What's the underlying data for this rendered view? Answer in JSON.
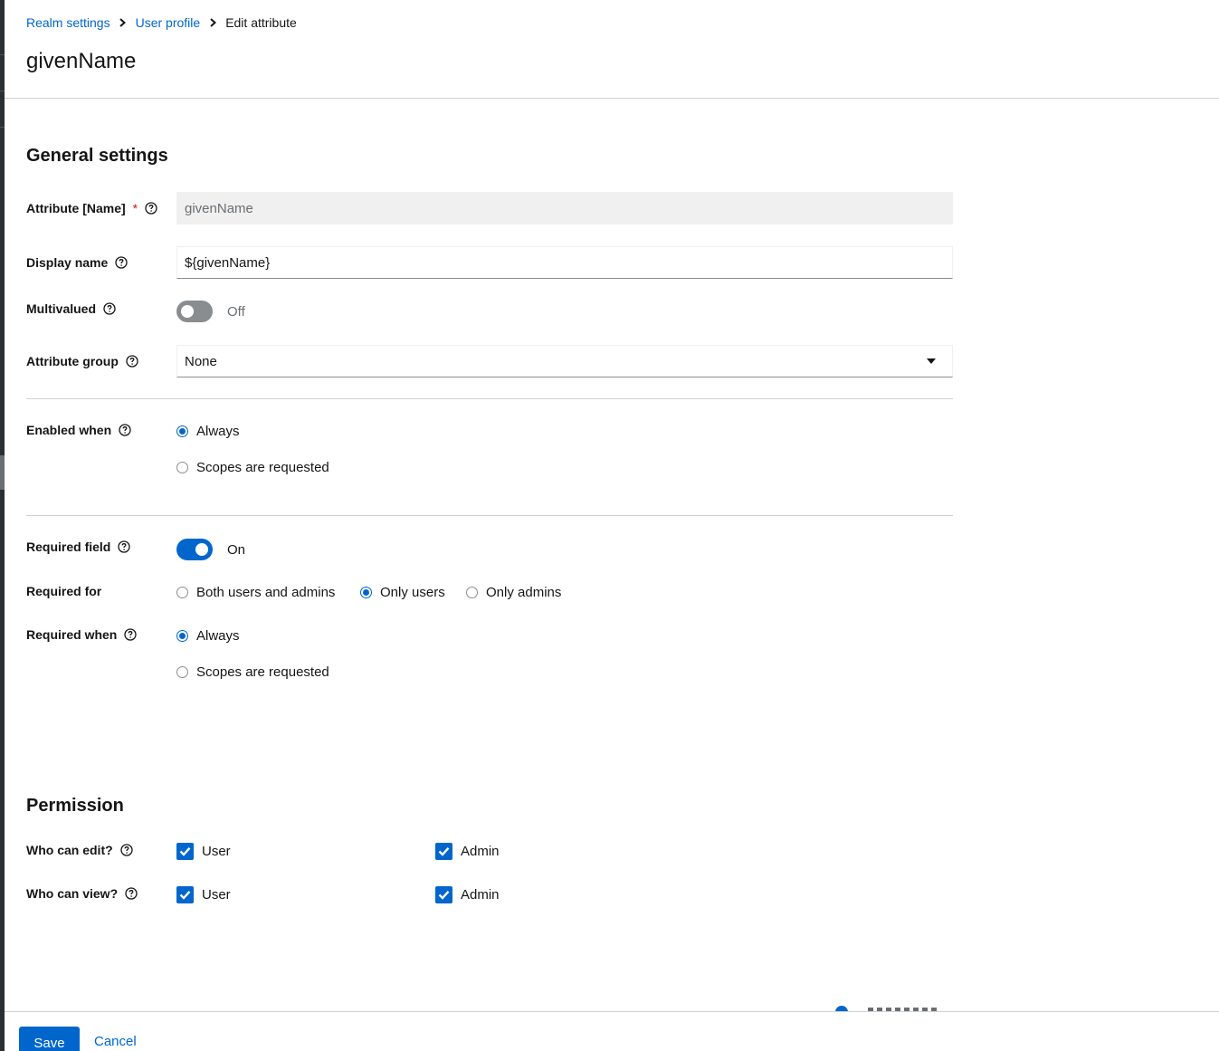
{
  "breadcrumb": {
    "items": [
      {
        "label": "Realm settings"
      },
      {
        "label": "User profile"
      }
    ],
    "current": "Edit attribute"
  },
  "page_title": "givenName",
  "general": {
    "title": "General settings",
    "attribute_name": {
      "label": "Attribute [Name]",
      "required_mark": "*",
      "value": "givenName"
    },
    "display_name": {
      "label": "Display name",
      "value": "${givenName}"
    },
    "multivalued": {
      "label": "Multivalued",
      "state": "Off",
      "enabled": false
    },
    "attribute_group": {
      "label": "Attribute group",
      "value": "None"
    },
    "enabled_when": {
      "label": "Enabled when",
      "options": [
        "Always",
        "Scopes are requested"
      ],
      "selected": "Always"
    },
    "required_field": {
      "label": "Required field",
      "state": "On",
      "enabled": true
    },
    "required_for": {
      "label": "Required for",
      "options": [
        "Both users and admins",
        "Only users",
        "Only admins"
      ],
      "selected": "Only users"
    },
    "required_when": {
      "label": "Required when",
      "options": [
        "Always",
        "Scopes are requested"
      ],
      "selected": "Always"
    }
  },
  "permission": {
    "title": "Permission",
    "who_can_edit": {
      "label": "Who can edit?",
      "user": "User",
      "admin": "Admin",
      "user_checked": true,
      "admin_checked": true
    },
    "who_can_view": {
      "label": "Who can view?",
      "user": "User",
      "admin": "Admin",
      "user_checked": true,
      "admin_checked": true
    }
  },
  "footer": {
    "save_label": "Save",
    "cancel_label": "Cancel"
  },
  "colors": {
    "accent": "#0066cc",
    "link": "#0066cc",
    "required": "#c9190b"
  },
  "icons": {
    "help": "help-circle-icon",
    "breadcrumb_separator": "chevron-right-icon",
    "select_caret": "caret-down-icon",
    "checkbox": "checkmark-icon"
  }
}
